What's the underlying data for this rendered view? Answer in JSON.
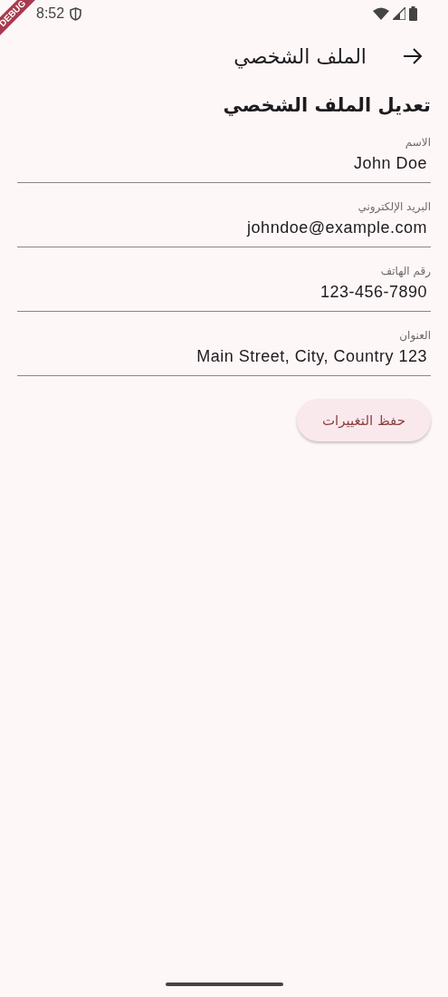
{
  "status_bar": {
    "time": "8:52",
    "debug_banner": "DEBUG"
  },
  "app_bar": {
    "title": "الملف الشخصي"
  },
  "heading": "تعديل الملف الشخصي",
  "fields": [
    {
      "label": "الاسم",
      "value": "John Doe"
    },
    {
      "label": "البريد الإلكتروني",
      "value": "johndoe@example.com"
    },
    {
      "label": "رقم الهاتف",
      "value": "123-456-7890"
    },
    {
      "label": "العنوان",
      "value": "Main Street, City, Country 123"
    }
  ],
  "save_button": "حفظ التغييرات"
}
